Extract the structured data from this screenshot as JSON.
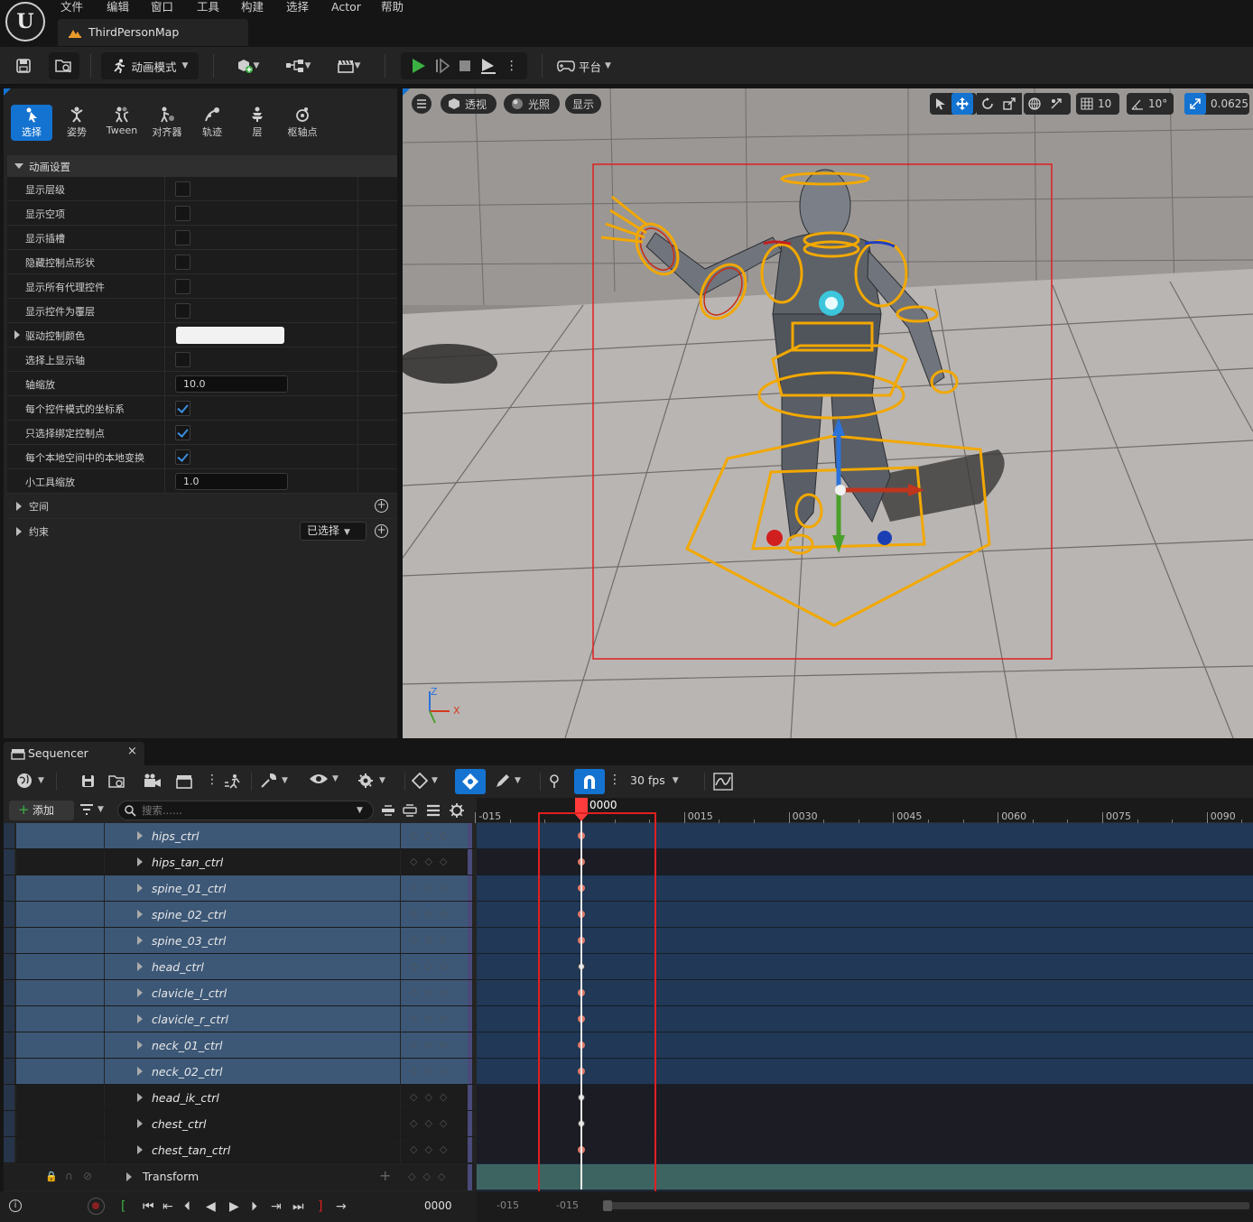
{
  "menu": {
    "items": [
      "文件",
      "编辑",
      "窗口",
      "工具",
      "构建",
      "选择",
      "Actor",
      "帮助"
    ]
  },
  "map_tab": {
    "title": "ThirdPersonMap"
  },
  "toolbar": {
    "mode_label": "动画模式",
    "platform_label": "平台"
  },
  "modes": [
    {
      "label": "选择",
      "icon": "select-arrow-icon"
    },
    {
      "label": "姿势",
      "icon": "pose-figure-icon"
    },
    {
      "label": "Tween",
      "icon": "tween-figure-icon"
    },
    {
      "label": "对齐器",
      "icon": "aligner-figure-icon"
    },
    {
      "label": "轨迹",
      "icon": "trail-icon"
    },
    {
      "label": "层",
      "icon": "layer-icon"
    },
    {
      "label": "枢轴点",
      "icon": "pivot-icon"
    }
  ],
  "anim_settings": {
    "header": "动画设置",
    "rows": [
      {
        "label": "显示层级",
        "type": "check",
        "checked": false
      },
      {
        "label": "显示空项",
        "type": "check",
        "checked": false
      },
      {
        "label": "显示插槽",
        "type": "check",
        "checked": false
      },
      {
        "label": "隐藏控制点形状",
        "type": "check",
        "checked": false
      },
      {
        "label": "显示所有代理控件",
        "type": "check",
        "checked": false
      },
      {
        "label": "显示控件为覆层",
        "type": "check",
        "checked": false
      },
      {
        "label": "驱动控制颜色",
        "type": "color",
        "color": "#f2f2f2"
      },
      {
        "label": "选择上显示轴",
        "type": "check",
        "checked": false
      },
      {
        "label": "轴缩放",
        "type": "number",
        "value": "10.0"
      },
      {
        "label": "每个控件模式的坐标系",
        "type": "check",
        "checked": true
      },
      {
        "label": "只选择绑定控制点",
        "type": "check",
        "checked": true
      },
      {
        "label": "每个本地空间中的本地变换",
        "type": "check",
        "checked": true
      },
      {
        "label": "小工具缩放",
        "type": "number",
        "value": "1.0"
      }
    ],
    "space_label": "空间",
    "constraint_label": "约束",
    "constraint_dropdown": "已选择"
  },
  "viewport": {
    "perspective": "透视",
    "lighting": "光照",
    "show": "显示",
    "grid_snap": "10",
    "rot_snap": "10°",
    "scale_snap": "0.0625",
    "axis_z": "Z",
    "axis_x": "X"
  },
  "sequencer": {
    "tab_title": "Sequencer",
    "fps": "30 fps",
    "add_label": "添加",
    "search_placeholder": "搜索......",
    "current_frame": "0000",
    "ruler_ticks": [
      "-015",
      "0015",
      "0030",
      "0045",
      "0060",
      "0075",
      "0090"
    ],
    "tracks": [
      {
        "name": "hips_ctrl",
        "selected": true,
        "key": "red"
      },
      {
        "name": "hips_tan_ctrl",
        "selected": false,
        "key": "red"
      },
      {
        "name": "spine_01_ctrl",
        "selected": true,
        "key": "red"
      },
      {
        "name": "spine_02_ctrl",
        "selected": true,
        "key": "red"
      },
      {
        "name": "spine_03_ctrl",
        "selected": true,
        "key": "red"
      },
      {
        "name": "head_ctrl",
        "selected": true,
        "key": "white"
      },
      {
        "name": "clavicle_l_ctrl",
        "selected": true,
        "key": "red"
      },
      {
        "name": "clavicle_r_ctrl",
        "selected": true,
        "key": "red"
      },
      {
        "name": "neck_01_ctrl",
        "selected": true,
        "key": "red"
      },
      {
        "name": "neck_02_ctrl",
        "selected": true,
        "key": "red"
      },
      {
        "name": "head_ik_ctrl",
        "selected": false,
        "key": "white"
      },
      {
        "name": "chest_ctrl",
        "selected": false,
        "key": "white"
      },
      {
        "name": "chest_tan_ctrl",
        "selected": false,
        "key": "red"
      }
    ],
    "transform_label": "Transform",
    "bottom_frame": "0000",
    "bottom_start": "-015",
    "bottom_start2": "-015"
  },
  "colors": {
    "accent": "#1473d1",
    "selection_box": "#e02020",
    "gizmo": "#f0a000",
    "playhead": "#ff3b3b"
  }
}
